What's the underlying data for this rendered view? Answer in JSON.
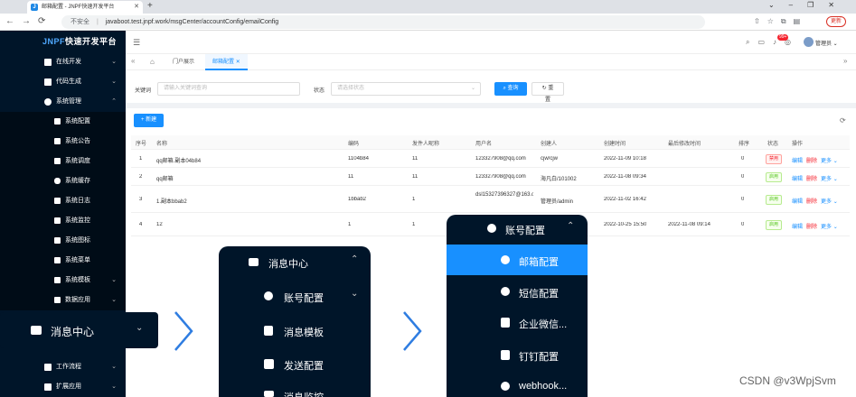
{
  "browser": {
    "tab_title": "邮箱配置 - JNPF快速开发平台",
    "address_insecure": "不安全",
    "address_url": "javaboot.test.jnpf.work/msgCenter/accountConfig/emailConfig",
    "update_label": "更新"
  },
  "sidebar": {
    "logo_a": "JNPF",
    "logo_b": "快速开发平台",
    "items": [
      {
        "label": "在线开发",
        "expanded": false
      },
      {
        "label": "代码生成",
        "expanded": false
      },
      {
        "label": "系统管理",
        "expanded": true
      }
    ],
    "sub_items": [
      "系统配置",
      "系统公告",
      "系统调度",
      "系统缓存",
      "系统日志",
      "系统监控",
      "系统图标",
      "系统菜单",
      "系统模板",
      "数据应用"
    ],
    "bottom_items": [
      "工作流程",
      "扩展应用"
    ]
  },
  "header": {
    "notification_count": "99+",
    "user_name": "管理员"
  },
  "tabs": {
    "items": [
      {
        "label": "门户展示",
        "active": false
      },
      {
        "label": "邮箱配置",
        "active": true
      }
    ]
  },
  "search": {
    "keyword_label": "关键词",
    "keyword_placeholder": "请输入关键词查询",
    "status_label": "状态",
    "status_placeholder": "请选择状态",
    "search_label": "查询",
    "reset_label": "重置"
  },
  "toolbar": {
    "new_label": "新建"
  },
  "table": {
    "columns": [
      "序号",
      "名称",
      "编码",
      "发件人昵称",
      "用户名",
      "创建人",
      "创建时间",
      "最后修改时间",
      "排序",
      "状态",
      "操作"
    ],
    "rows": [
      {
        "index": "1",
        "name": "qq邮箱.副本04b84",
        "code": "1104b84",
        "sender": "11",
        "username": "123327908@qq.com",
        "creator": "cjw/cjw",
        "created": "2022-11-09 10:18",
        "modified": "",
        "sort": "0",
        "status": "禁用",
        "status_type": "disabled"
      },
      {
        "index": "2",
        "name": "qq邮箱",
        "code": "11",
        "sender": "11",
        "username": "123327908@qq.com",
        "creator": "海凡白/101002",
        "created": "2022-11-08 09:34",
        "modified": "",
        "sort": "0",
        "status": "启用",
        "status_type": "enabled"
      },
      {
        "index": "3",
        "name": "1.副本bbab2",
        "code": "1bbab2",
        "sender": "1",
        "username": "dsl15327396327@163.com",
        "creator": "管理员/admin",
        "created": "2022-11-02 16:42",
        "modified": "",
        "sort": "0",
        "status": "启用",
        "status_type": "enabled"
      },
      {
        "index": "4",
        "name": "12",
        "code": "1",
        "sender": "1",
        "username": "",
        "creator": "",
        "created": "2022-10-25 15:50",
        "modified": "2022-11-08 09:14",
        "sort": "0",
        "status": "启用",
        "status_type": "enabled"
      }
    ],
    "op_edit": "编辑",
    "op_delete": "删除",
    "op_more": "更多"
  },
  "overlays": {
    "panel1_label": "消息中心",
    "panel2_title": "消息中心",
    "panel2_items": [
      "账号配置",
      "消息模板",
      "发送配置",
      "消息监控"
    ],
    "panel3_title": "账号配置",
    "panel3_items": [
      "邮箱配置",
      "短信配置",
      "企业微信...",
      "钉钉配置",
      "webhook..."
    ]
  },
  "watermark": "CSDN @v3WpjSvm"
}
